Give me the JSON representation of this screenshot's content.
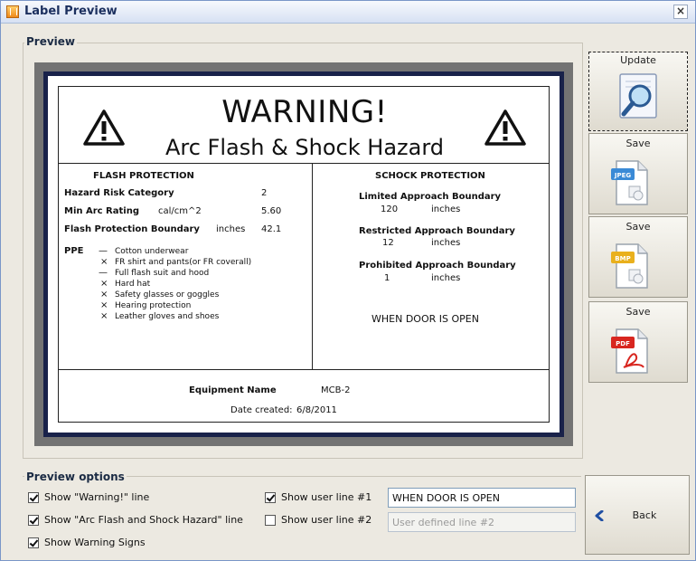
{
  "window": {
    "title": "Label Preview",
    "close_glyph": "×"
  },
  "preview": {
    "group_label": "Preview",
    "label": {
      "title": "WARNING!",
      "subtitle": "Arc Flash & Shock Hazard",
      "flash": {
        "heading": "FLASH PROTECTION",
        "hrc_label": "Hazard Risk Category",
        "hrc_value": "2",
        "arc_label": "Min Arc Rating",
        "arc_unit": "cal/cm^2",
        "arc_value": "5.60",
        "fpb_label": "Flash Protection Boundary",
        "fpb_unit": "inches",
        "fpb_value": "42.1",
        "ppe_label": "PPE",
        "ppe_items": [
          {
            "mark": "—",
            "text": "Cotton underwear"
          },
          {
            "mark": "×",
            "text": "FR shirt and pants(or FR coverall)"
          },
          {
            "mark": "—",
            "text": "Full flash suit and hood"
          },
          {
            "mark": "×",
            "text": "Hard hat"
          },
          {
            "mark": "×",
            "text": "Safety glasses or goggles"
          },
          {
            "mark": "×",
            "text": "Hearing protection"
          },
          {
            "mark": "×",
            "text": "Leather gloves and shoes"
          }
        ]
      },
      "shock": {
        "heading": "SCHOCK PROTECTION",
        "limited_label": "Limited Approach Boundary",
        "limited_value": "120",
        "limited_unit": "inches",
        "restricted_label": "Restricted Approach Boundary",
        "restricted_value": "12",
        "restricted_unit": "inches",
        "prohibited_label": "Prohibited Approach Boundary",
        "prohibited_value": "1",
        "prohibited_unit": "inches",
        "note": "WHEN DOOR IS OPEN"
      },
      "equipment_label": "Equipment Name",
      "equipment_value": "MCB-2",
      "date_label": "Date created:",
      "date_value": "6/8/2011"
    }
  },
  "buttons": {
    "update": "Update",
    "save_jpeg": "Save",
    "save_bmp": "Save",
    "save_pdf": "Save",
    "back": "Back",
    "jpeg_badge": "JPEG",
    "bmp_badge": "BMP",
    "pdf_badge": "PDF"
  },
  "options": {
    "group_label": "Preview options",
    "show_warning": {
      "label": "Show \"Warning!\" line",
      "checked": true
    },
    "show_arcflash": {
      "label": "Show \"Arc Flash and Shock Hazard\" line",
      "checked": true
    },
    "show_signs": {
      "label": "Show Warning Signs",
      "checked": true
    },
    "user_line1": {
      "label": "Show user line #1",
      "checked": true,
      "value": "WHEN DOOR IS OPEN"
    },
    "user_line2": {
      "label": "Show user line #2",
      "checked": false,
      "placeholder": "User defined line #2"
    }
  },
  "colors": {
    "accent": "#3a6fc4",
    "pdf_red": "#d8261f",
    "jpeg_blue": "#3a8ad6",
    "bmp_yellow": "#e9b01d"
  }
}
